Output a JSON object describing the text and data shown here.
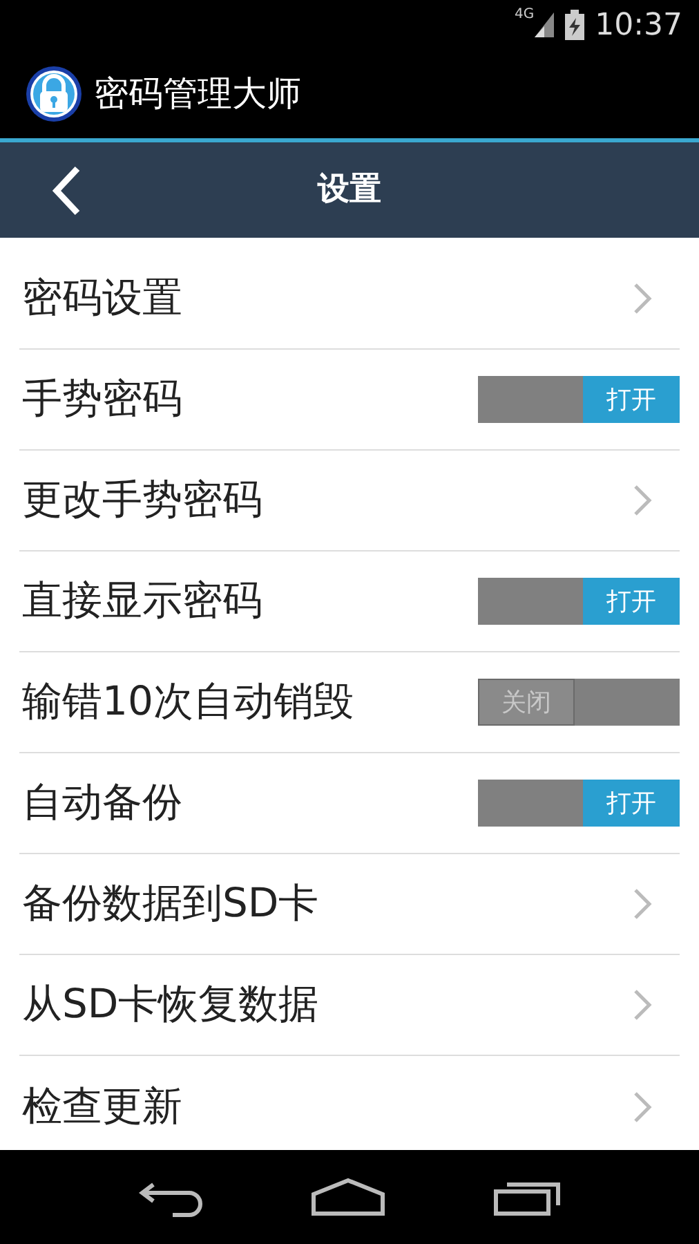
{
  "status_bar": {
    "network": "4G",
    "time": "10:37"
  },
  "app_bar": {
    "title": "密码管理大师"
  },
  "header": {
    "title": "设置"
  },
  "settings": [
    {
      "kind": "link",
      "label": "密码设置"
    },
    {
      "kind": "toggle",
      "label": "手势密码",
      "on": true,
      "switch_text": "打开"
    },
    {
      "kind": "link",
      "label": "更改手势密码"
    },
    {
      "kind": "toggle",
      "label": "直接显示密码",
      "on": true,
      "switch_text": "打开"
    },
    {
      "kind": "toggle",
      "label": "输错10次自动销毁",
      "on": false,
      "switch_text": "关闭"
    },
    {
      "kind": "toggle",
      "label": "自动备份",
      "on": true,
      "switch_text": "打开"
    },
    {
      "kind": "link",
      "label": "备份数据到SD卡"
    },
    {
      "kind": "link",
      "label": "从SD卡恢复数据"
    },
    {
      "kind": "link",
      "label": "检查更新"
    }
  ]
}
